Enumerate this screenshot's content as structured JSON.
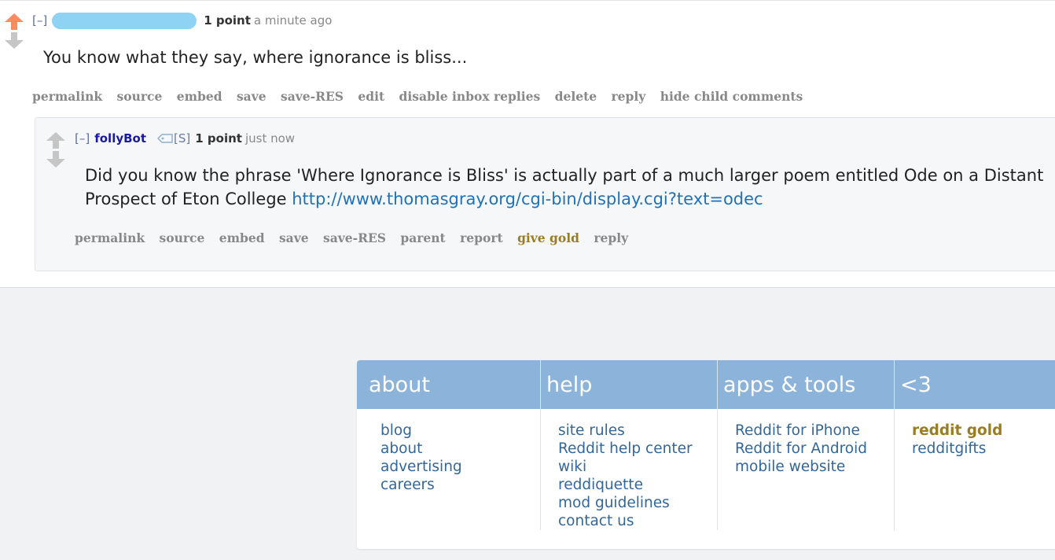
{
  "parent_comment": {
    "expand": "[–]",
    "score": "1 point",
    "time": "a minute ago",
    "body": "You know what they say, where ignorance is bliss...",
    "buttons": [
      "permalink",
      "source",
      "embed",
      "save",
      "save-RES",
      "edit",
      "disable inbox replies",
      "delete",
      "reply",
      "hide child comments"
    ]
  },
  "child_comment": {
    "expand": "[–]",
    "author": "follyBot",
    "flair": "[S]",
    "score": "1 point",
    "time": "just now",
    "body_text": "Did you know the phrase 'Where Ignorance is Bliss' is actually part of a much larger poem entitled Ode on a Distant Prospect of Eton College ",
    "link": "http://www.thomasgray.org/cgi-bin/display.cgi?text=odec",
    "buttons": [
      "permalink",
      "source",
      "embed",
      "save",
      "save-RES",
      "parent",
      "report",
      "give gold",
      "reply"
    ]
  },
  "footer": {
    "columns": [
      {
        "title": "about",
        "links": [
          "blog",
          "about",
          "advertising",
          "careers"
        ]
      },
      {
        "title": "help",
        "links": [
          "site rules",
          "Reddit help center",
          "wiki",
          "reddiquette",
          "mod guidelines",
          "contact us"
        ]
      },
      {
        "title": "apps & tools",
        "links": [
          "Reddit for iPhone",
          "Reddit for Android",
          "mobile website"
        ]
      },
      {
        "title": "<3",
        "links": [
          "reddit gold",
          "redditgifts"
        ]
      }
    ]
  },
  "colors": {
    "upvote_active": "#ff8b60",
    "vote_inactive": "#c6c6c6",
    "link": "#1f72b8",
    "footer_header": "#8cb3d9",
    "gold": "#9a7d22"
  },
  "icons": {
    "upvote_active": "upvote-arrow-icon",
    "downvote": "downvote-arrow-icon",
    "flair_tag": "tag-icon"
  }
}
